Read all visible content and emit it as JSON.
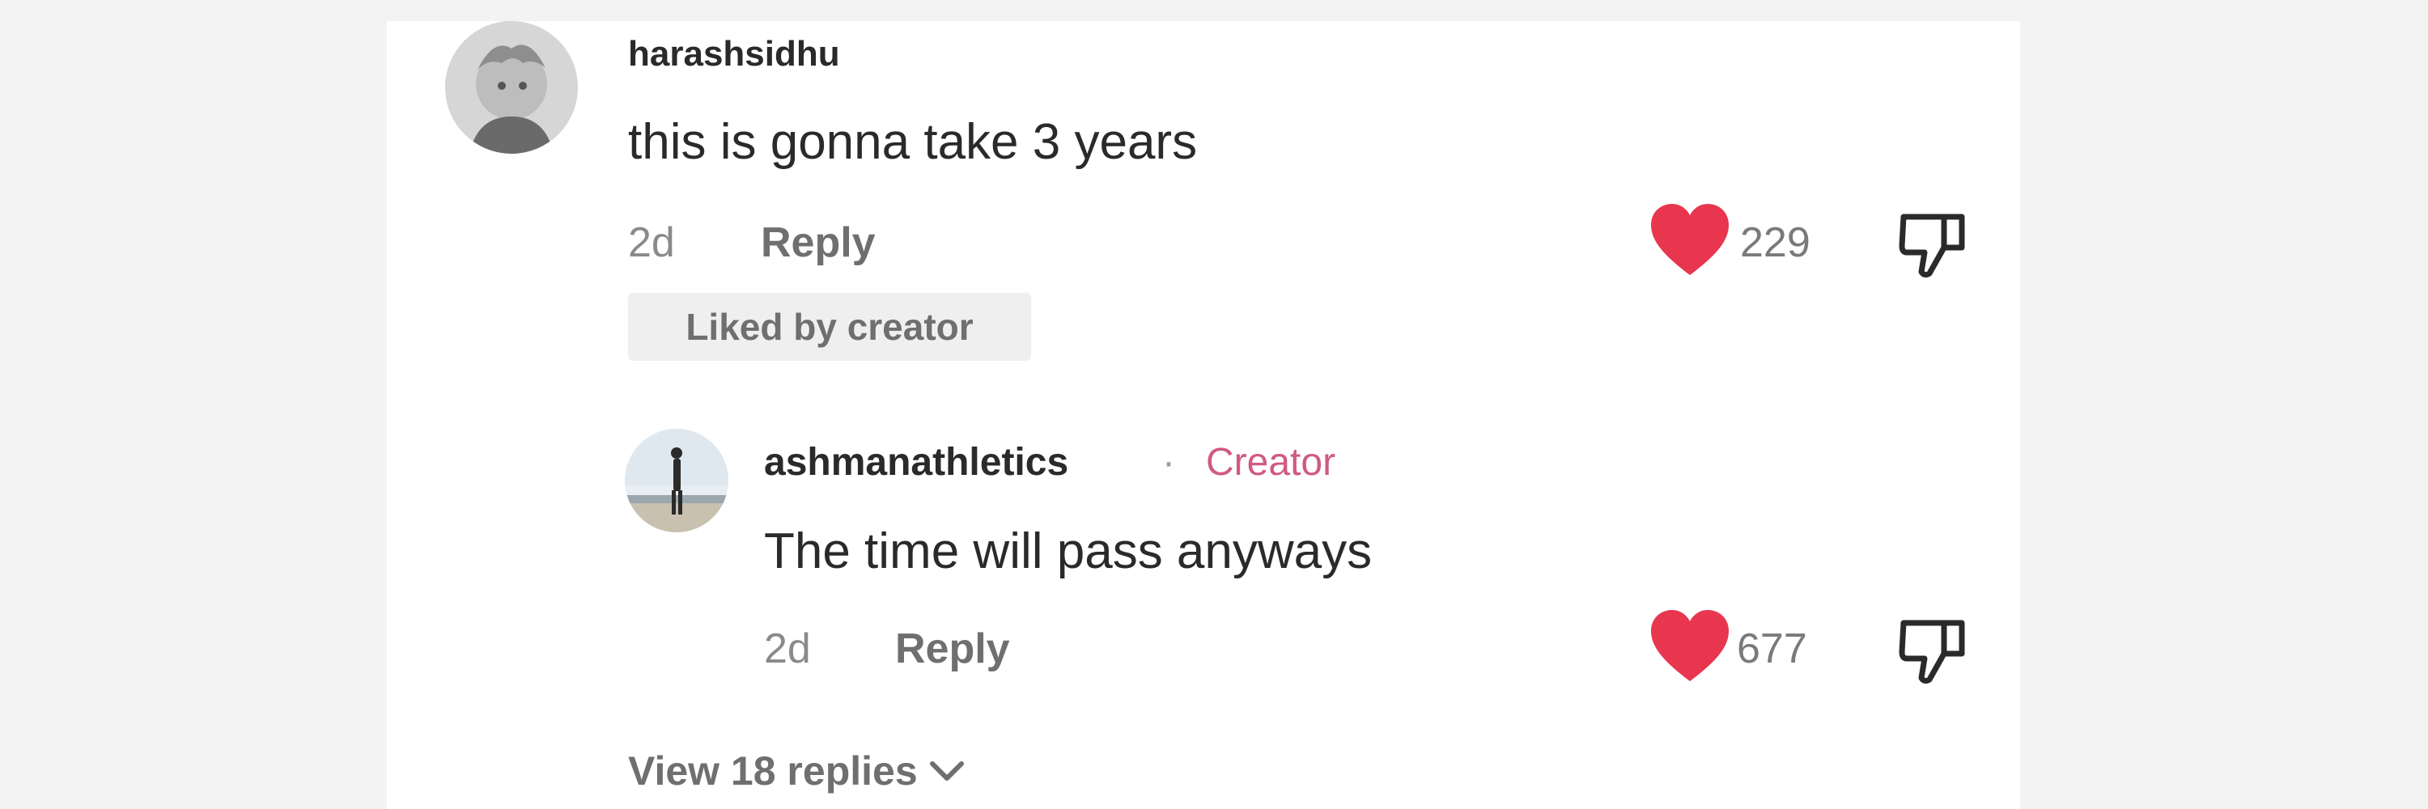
{
  "comments": [
    {
      "username": "harashsidhu",
      "text": "this is gonna take 3 years",
      "time": "2d",
      "reply_label": "Reply",
      "badge": "Liked by creator",
      "likes": "229"
    }
  ],
  "reply": {
    "username": "ashmanathletics",
    "separator": "·",
    "role": "Creator",
    "text": "The time will pass anyways",
    "time": "2d",
    "reply_label": "Reply",
    "likes": "677"
  },
  "view_replies": "View 18 replies",
  "colors": {
    "heart": "#e8364f",
    "creator": "#d05a82",
    "background": "#f3f3f3",
    "panel": "#ffffff"
  },
  "icons": {
    "like": "heart-icon",
    "dislike": "thumbs-down-icon",
    "expand": "chevron-down-icon"
  }
}
